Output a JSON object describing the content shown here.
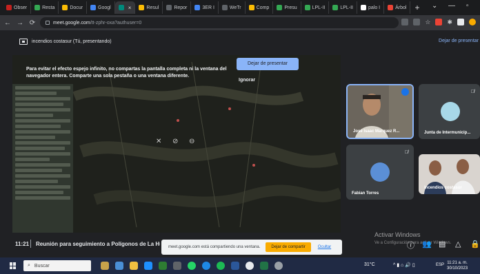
{
  "browser": {
    "tabs": [
      {
        "label": "Obser",
        "color": "#c5221f",
        "icon": "gmail-icon"
      },
      {
        "label": "Resta",
        "color": "#34a853",
        "icon": "sheets-icon"
      },
      {
        "label": "Docur",
        "color": "#fbbc04",
        "icon": "drive-icon"
      },
      {
        "label": "Googl",
        "color": "#4285f4",
        "icon": "docs-icon"
      },
      {
        "label": "",
        "color": "#00897b",
        "icon": "meet-icon",
        "active": true
      },
      {
        "label": "Resul",
        "color": "#fbbc04",
        "icon": "drive-icon"
      },
      {
        "label": "Repor",
        "color": "#5f6368",
        "icon": "globe-icon"
      },
      {
        "label": "3ER I",
        "color": "#4285f4",
        "icon": "docs-icon"
      },
      {
        "label": "WeTr",
        "color": "#5f6368",
        "icon": "wetransfer-icon"
      },
      {
        "label": "Comp",
        "color": "#fbbc04",
        "icon": "drive-icon"
      },
      {
        "label": "Presu",
        "color": "#34a853",
        "icon": "sheets-icon"
      },
      {
        "label": "LPL-II",
        "color": "#34a853",
        "icon": "maps-icon"
      },
      {
        "label": "LPL-II",
        "color": "#34a853",
        "icon": "maps-icon"
      },
      {
        "label": "palo I",
        "color": "#ffffff",
        "icon": "chrome-icon"
      },
      {
        "label": "Árbol",
        "color": "#ea4335",
        "icon": "tree-icon"
      }
    ],
    "new_tab": "+",
    "url_host": "meet.google.com",
    "url_path": "/tt-zphr-oxa?authuser=0"
  },
  "presenting": {
    "label": "incendios costasur (Tú, presentando)",
    "stop_link": "Dejar de presentar"
  },
  "shared_screen": {
    "warning_text": "Para evitar el efecto espejo infinito, no compartas la pantalla completa ni la ventana del navegador entera. Comparte una sola pestaña o una ventana diferente.",
    "stop_button": "Dejar de presentar",
    "ignore": "Ignorar"
  },
  "participants": [
    {
      "name": "José Isaac Marquez R...",
      "speaking": true
    },
    {
      "name": "Junta de Intermunicip...",
      "muted": true
    },
    {
      "name": "Fabian Torres",
      "muted": true
    },
    {
      "name": "incendios costasur"
    }
  ],
  "meeting": {
    "time": "11:21",
    "separator": "|",
    "title": "Reunión para seguimiento a Polígonos de La Hu"
  },
  "share_notice": {
    "message": "meet.google.com está compartiendo una ventana.",
    "stop_button": "Dejar de compartir",
    "hide": "Ocultar"
  },
  "windows_activation": {
    "title": "Activar Windows",
    "subtitle": "Ve a Configuración para activar Windows."
  },
  "taskbar": {
    "search": "Buscar",
    "temperature": "31°C",
    "language": "ESP",
    "time": "11:21 a. m.",
    "date": "30/10/2023"
  }
}
